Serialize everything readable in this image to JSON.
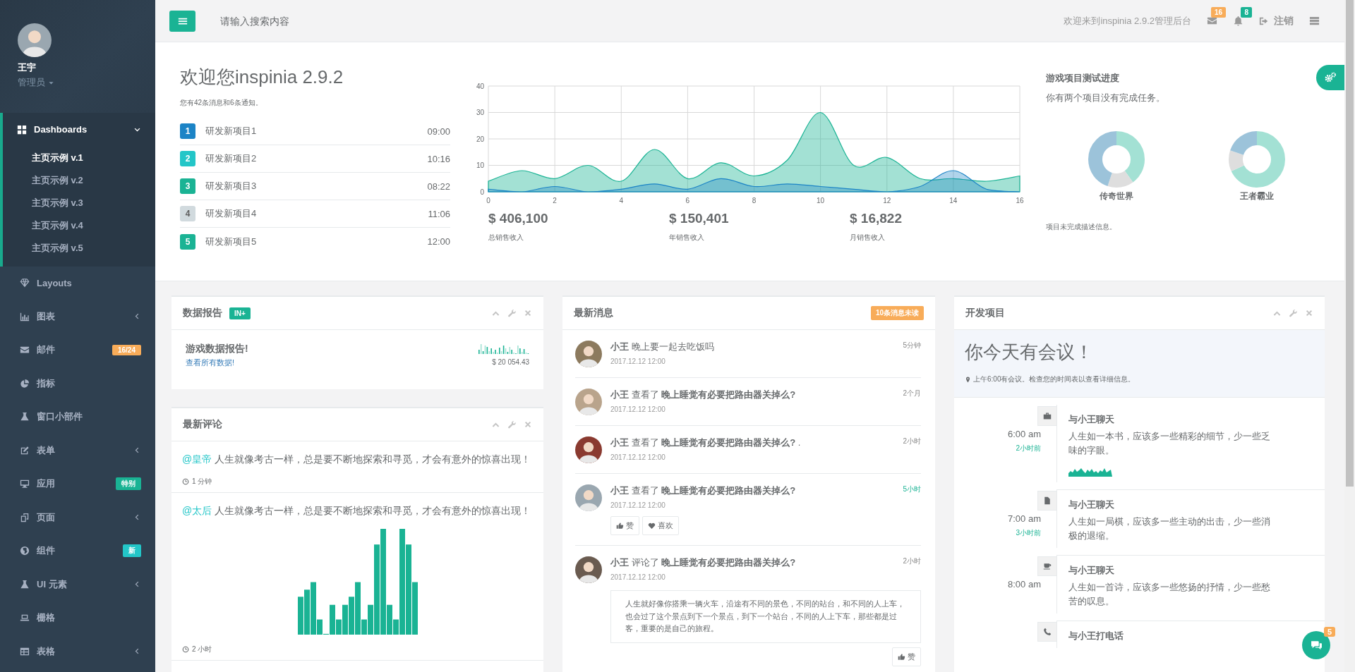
{
  "sidebar": {
    "profile": {
      "name": "王宇",
      "role": "管理员"
    },
    "items": [
      {
        "label": "Dashboards",
        "kind": "group",
        "expanded": true,
        "selected": true,
        "children": [
          {
            "label": "主页示例 v.1",
            "selected": true
          },
          {
            "label": "主页示例 v.2",
            "selected": false
          },
          {
            "label": "主页示例 v.3",
            "selected": false
          },
          {
            "label": "主页示例 v.4",
            "selected": false
          },
          {
            "label": "主页示例 v.5",
            "selected": false
          }
        ]
      },
      {
        "label": "Layouts",
        "kind": "link",
        "selected": false
      },
      {
        "label": "图表",
        "kind": "group",
        "expanded": false,
        "selected": false
      },
      {
        "label": "邮件",
        "kind": "link",
        "selected": false,
        "badge": {
          "text": "16/24",
          "color": "#f8ac59"
        }
      },
      {
        "label": "指标",
        "kind": "link",
        "selected": false
      },
      {
        "label": "窗口小部件",
        "kind": "link",
        "selected": false
      },
      {
        "label": "表单",
        "kind": "group",
        "expanded": false,
        "selected": false
      },
      {
        "label": "应用",
        "kind": "link",
        "selected": false,
        "badge": {
          "text": "特别",
          "color": "#1ab394"
        }
      },
      {
        "label": "页面",
        "kind": "group",
        "expanded": false,
        "selected": false
      },
      {
        "label": "组件",
        "kind": "link",
        "selected": false,
        "badge": {
          "text": "新",
          "color": "#23c6c8"
        }
      },
      {
        "label": "UI 元素",
        "kind": "group",
        "expanded": false,
        "selected": false
      },
      {
        "label": "栅格",
        "kind": "link",
        "selected": false
      },
      {
        "label": "表格",
        "kind": "group",
        "expanded": false,
        "selected": false
      }
    ]
  },
  "topbar": {
    "search": {
      "placeholder": "请输入搜索内容"
    },
    "welcome": "欢迎来到inspinia 2.9.2管理后台",
    "mail_count": "16",
    "alert_count": "8",
    "logout": "注销"
  },
  "hero": {
    "title": "欢迎您inspinia 2.9.2",
    "subtitle": "您有42条消息和6条通知。",
    "projects": [
      {
        "number": "1",
        "label": "研发新项目1",
        "time": "09:00",
        "color": "#1c84c6"
      },
      {
        "number": "2",
        "label": "研发新项目2",
        "time": "10:16",
        "color": "#23c6c8"
      },
      {
        "number": "3",
        "label": "研发新项目3",
        "time": "08:22",
        "color": "#1ab394"
      },
      {
        "number": "4",
        "label": "研发新项目4",
        "time": "11:06",
        "color": "#d1dade"
      },
      {
        "number": "5",
        "label": "研发新项目5",
        "time": "12:00",
        "color": "#1ab394"
      }
    ],
    "chart_data": {
      "type": "area",
      "grid": true,
      "x": [
        0,
        1,
        2,
        3,
        4,
        5,
        6,
        7,
        8,
        9,
        10,
        11,
        12,
        13,
        14,
        15,
        16
      ],
      "xlim": [
        0,
        16
      ],
      "ylim": [
        0,
        40
      ],
      "xticks": [
        0,
        2,
        4,
        6,
        8,
        10,
        12,
        14,
        16
      ],
      "yticks": [
        0,
        10,
        20,
        30,
        40
      ],
      "series": [
        {
          "color": "#1ab394",
          "values": [
            4,
            8,
            5,
            10,
            4,
            16,
            5,
            11,
            6,
            12,
            30,
            10,
            13,
            5,
            5,
            4,
            6
          ]
        },
        {
          "color": "#1c84c6",
          "values": [
            1,
            0,
            2,
            0,
            1,
            3,
            1,
            5,
            2,
            3,
            2,
            1,
            0,
            2,
            8,
            1,
            0
          ]
        }
      ]
    },
    "stats": [
      {
        "value": "$ 406,100",
        "label": "总销售收入"
      },
      {
        "value": "$ 150,401",
        "label": "年销售收入"
      },
      {
        "value": "$ 16,822",
        "label": "月销售收入"
      }
    ],
    "progress": {
      "title": "游戏项目测试进度",
      "subtitle": "你有两个项目没有完成任务。",
      "games": [
        {
          "name": "传奇世界"
        },
        {
          "name": "王者霸业"
        }
      ],
      "note": "项目未完成描述信息。"
    }
  },
  "report": {
    "title": "数据报告",
    "badge": "IN+",
    "heading": "游戏数据报告!",
    "link": "查看所有数据!",
    "amount": "$ 20 054.43"
  },
  "comments": {
    "title": "最新评论",
    "items": [
      {
        "kind": "text",
        "author": "@皇帝",
        "text": "人生就像考古一样，总是要不断地探索和寻觅，才会有意外的惊喜出现！",
        "time": "1 分钟"
      },
      {
        "kind": "chart",
        "author": "@太后",
        "text": "人生就像考古一样，总是要不断地探索和寻觅，才会有意外的惊喜出现！",
        "time": "2 小时"
      }
    ]
  },
  "messages": {
    "title": "最新消息",
    "badge": "10条消息未读",
    "items": [
      {
        "text": "**小王** 晚上要一起去吃饭吗",
        "date": "2017.12.12 12:00",
        "ago": "5分钟",
        "highlighted": false
      },
      {
        "text": "**小王** 查看了 **晚上睡觉有必要把路由器关掉么?**",
        "date": "2017.12.12 12:00",
        "ago": "2个月",
        "highlighted": false
      },
      {
        "text": "**小王** 查看了 **晚上睡觉有必要把路由器关掉么?** .",
        "date": "2017.12.12 12:00",
        "ago": "2小时",
        "highlighted": false
      },
      {
        "text": "**小王** 查看了 **晚上睡觉有必要把路由器关掉么?**",
        "date": "2017.12.12 12:00",
        "ago": "5小时",
        "highlighted": true,
        "actions": [
          {
            "kind": "like",
            "label": "赞"
          },
          {
            "kind": "love",
            "label": "喜欢"
          }
        ]
      },
      {
        "text": "**小王** 评论了 **晚上睡觉有必要把路由器关掉么?**",
        "date": "2017.12.12 12:00",
        "ago": "2小时",
        "highlighted": false,
        "quote": "人生就好像你搭乘一辆火车，沿途有不同的景色，不同的站台，和不同的人上车，也会过了这个景点到下一个景点，到下一个站台，不同的人上下车，那些都是过客，重要的是自己的旅程。",
        "reply": {
          "kind": "like",
          "label": "赞"
        }
      }
    ]
  },
  "timeline": {
    "title": "开发项目",
    "banner": {
      "title": "你今天有会议！",
      "note": "上午6:00有会议。检查您的时间表以查看详细信息。"
    },
    "entries": [
      {
        "kind": "briefcase",
        "time": "6:00 am",
        "ago": "2小时前",
        "title": "与小王聊天",
        "text": "人生如一本书，应该多一些精彩的细节，少一些乏味的字眼。",
        "graph": true
      },
      {
        "kind": "file",
        "time": "7:00 am",
        "ago": "3小时前",
        "title": "与小王聊天",
        "text": "人生如一局棋，应该多一些主动的出击，少一些消极的退缩。",
        "graph": false
      },
      {
        "kind": "coffee",
        "time": "8:00 am",
        "title": "与小王聊天",
        "text": "人生如一首诗，应该多一些悠扬的抒情，少一些愁苦的叹息。",
        "graph": false
      },
      {
        "kind": "phone",
        "title": "与小王打电话",
        "graph": false
      }
    ]
  },
  "chat": {
    "count": "5"
  }
}
